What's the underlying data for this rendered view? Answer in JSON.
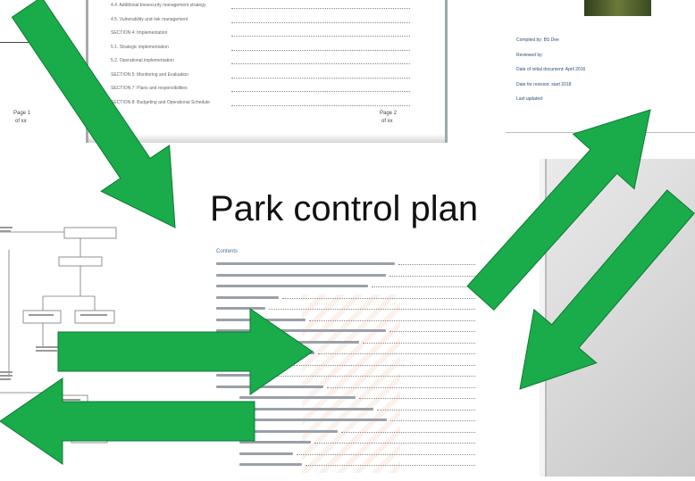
{
  "title": "Park control plan",
  "toc_top": {
    "lines": [
      "4.4. Additional biosecurity management strategy",
      "4.5. Vulnerability and risk management",
      "SECTION 4: Implementation",
      "5.1. Strategic implementation",
      "5.2. Operational implementation",
      "SECTION 5: Monitoring and Evaluation",
      "SECTION 7: Plans and responsibilities",
      "SECTION 8: Budgeting and Operational Schedule"
    ],
    "footer_left": "Page 1",
    "footer_left_sub": "of xx",
    "footer_right": "Page 2",
    "footer_right_sub": "of xx"
  },
  "cover": {
    "lines": [
      "Compiled by: BS Dee",
      "Reviewed by:",
      "Date of initial document: April 2016",
      "Date for revision: start 2018",
      "Last updated:"
    ]
  },
  "toc_main": {
    "heading": "Contents"
  },
  "colors": {
    "arrow": "#1aab4b",
    "arrow_stroke": "#0f7a33",
    "right_panel": "#d3d3d3"
  }
}
